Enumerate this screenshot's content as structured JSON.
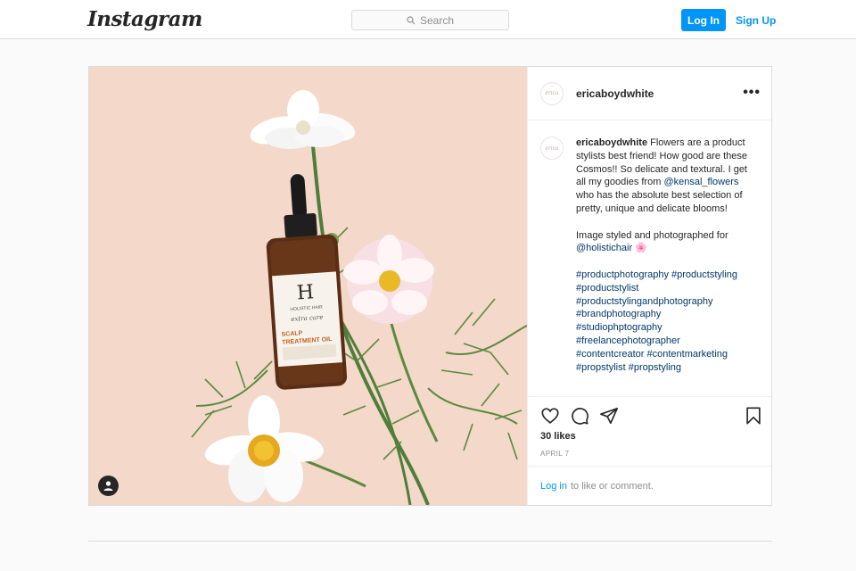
{
  "nav": {
    "logo": "Instagram",
    "search_placeholder": "Search",
    "login": "Log In",
    "signup": "Sign Up"
  },
  "post": {
    "username": "ericaboydwhite",
    "avatar_text": "erica",
    "caption": {
      "username": "ericaboydwhite",
      "text_1": " Flowers are a product stylists best friend! How good are these Cosmos!! So delicate and textural. I get all my goodies from ",
      "mention_1": "@kensal_flowers",
      "text_2": " who has the absolute best selection of pretty, unique and delicate blooms!",
      "text_3": "Image styled and photographed for ",
      "mention_2": "@holistichair",
      "emoji": "🌸",
      "hashtags": [
        "#productphotography",
        "#productstyling",
        "#productstylist",
        "#productstylingandphotography",
        "#brandphotography",
        "#studiophptography",
        "#freelancephotographer",
        "#contentcreator",
        "#contentmarketing",
        "#propstylist",
        "#propstyling"
      ]
    },
    "likes": "30 likes",
    "date": "APRIL 7",
    "login_link": "Log in",
    "login_suffix": "to like or comment.",
    "photo": {
      "bottle_brand": "HOLISTIC HAIR",
      "bottle_line": "extra care",
      "bottle_product_1": "SCALP",
      "bottle_product_2": "TREATMENT OIL"
    }
  },
  "colors": {
    "accent": "#0095f6",
    "link": "#00376b",
    "photo_bg": "#f4d8c9"
  }
}
